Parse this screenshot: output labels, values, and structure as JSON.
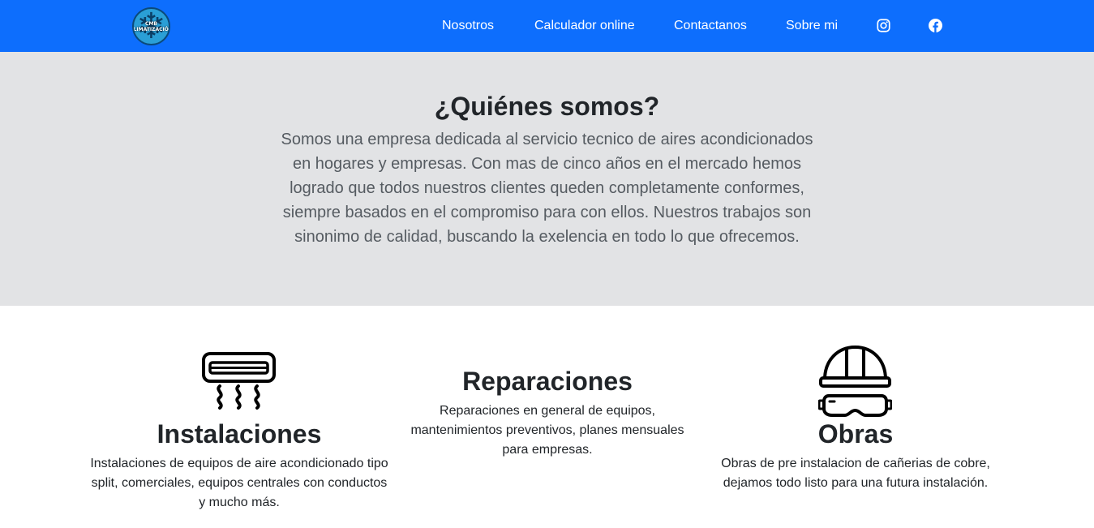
{
  "navbar": {
    "logo_text": "CMB CLIMATIZACIÓN",
    "links": [
      "Nosotros",
      "Calculador online",
      "Contactanos",
      "Sobre mi"
    ],
    "icons": [
      "instagram-icon",
      "facebook-icon"
    ],
    "bg_color": "#0d6efd"
  },
  "hero": {
    "title": "¿Quiénes somos?",
    "text": "Somos una empresa dedicada al servicio tecnico de aires acondicionados en hogares y empresas. Con mas de cinco años en el mercado hemos logrado que todos nuestros clientes queden completamente conformes, siempre basados en el compromiso para con ellos. Nuestros trabajos son sinonimo de calidad, buscando la exelencia en todo lo que ofrecemos.",
    "bg_color": "#e2e3e5"
  },
  "features": [
    {
      "icon": "air-conditioner-icon",
      "title": "Instalaciones",
      "text": "Instalaciones de equipos de aire acondicionado tipo split, comerciales, equipos centrales con conductos y mucho más."
    },
    {
      "title": "Reparaciones",
      "text": "Reparaciones en general de equipos, mantenimientos preventivos, planes mensuales para empresas."
    },
    {
      "icon": "hard-hat-goggles-icon",
      "title": "Obras",
      "text": "Obras de pre instalacion de cañerias de cobre, dejamos todo listo para una futura instalación."
    }
  ]
}
